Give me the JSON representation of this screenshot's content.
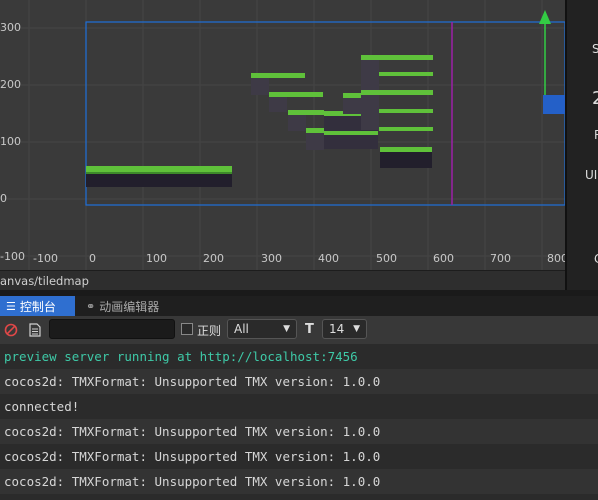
{
  "scene": {
    "y_ticks": [
      "300",
      "200",
      "100",
      "0"
    ],
    "y_ticks_bottom": "-100",
    "x_ticks": [
      "-100",
      "0",
      "100",
      "200",
      "300",
      "400",
      "500",
      "600",
      "700",
      "800"
    ],
    "canvas_color": "#1e6fd9",
    "line_color": "#9b1fa8",
    "gizmo_y_color": "#33cc44",
    "gizmo_x_color": "#2460c8"
  },
  "right_panel": {
    "labels": [
      "S",
      "2",
      "R",
      "UI",
      "C"
    ]
  },
  "breadcrumb": {
    "path": "anvas/tiledmap"
  },
  "tabs": {
    "console": "控制台",
    "animation": "动画编辑器"
  },
  "toolbar": {
    "filter_value": "",
    "regex_label": "正则",
    "level_value": "All",
    "font_icon": "T",
    "size_value": "14"
  },
  "console": {
    "rows": [
      {
        "text": "preview server running at http://localhost:7456",
        "kind": "info"
      },
      {
        "text": "cocos2d: TMXFormat: Unsupported TMX version: 1.0.0",
        "kind": "log"
      },
      {
        "text": "connected!",
        "kind": "log"
      },
      {
        "text": "cocos2d: TMXFormat: Unsupported TMX version: 1.0.0",
        "kind": "log"
      },
      {
        "text": "cocos2d: TMXFormat: Unsupported TMX version: 1.0.0",
        "kind": "log"
      },
      {
        "text": "cocos2d: TMXFormat: Unsupported TMX version: 1.0.0",
        "kind": "log"
      }
    ]
  }
}
